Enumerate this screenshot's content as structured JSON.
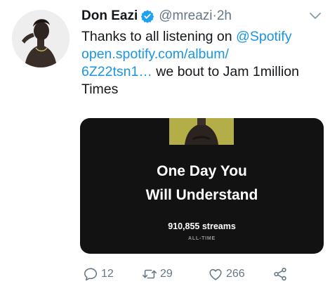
{
  "tweet": {
    "author_name": "Don Eazi",
    "handle": "@mreazi",
    "separator": " · ",
    "timestamp": "2h",
    "text_line1_prefix": "Thanks to all listening on ",
    "mention": "@Spotify",
    "link_line1": "open.spotify.com/album/",
    "link_line2": "6Z22tsn1…",
    "text_after_link": " we bout to Jam 1million",
    "text_last": "Times"
  },
  "card": {
    "title_line1": "One Day You",
    "title_line2": "Will Understand",
    "streams": "910,855 streams",
    "period": "ALL-TIME"
  },
  "actions": {
    "replies": "12",
    "retweets": "29",
    "likes": "266"
  },
  "colors": {
    "link": "#1b95e0",
    "muted": "#657786",
    "verified": "#1da1f2",
    "card_bg": "#121212"
  },
  "icons": [
    "verified-badge-icon",
    "chevron-down-icon",
    "reply-icon",
    "retweet-icon",
    "like-icon",
    "share-icon"
  ]
}
